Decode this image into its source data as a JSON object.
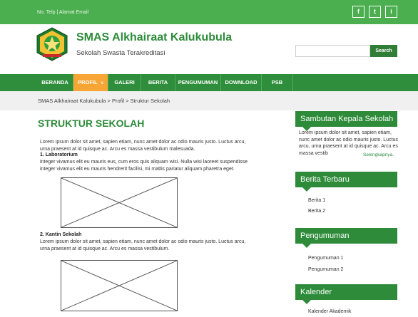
{
  "topbar": {
    "contact": "No. Telp | Alamat Email",
    "social": [
      "f",
      "t",
      "i"
    ]
  },
  "header": {
    "title": "SMAS Alkhairaat Kalukubula",
    "subtitle": "Sekolah Swasta Terakreditasi",
    "search_placeholder": "",
    "search_button": "Search"
  },
  "nav": {
    "items": [
      "BERANDA",
      "PROFIL",
      "GALERI",
      "BERITA",
      "PENGUMUMAN",
      "DOWNLOAD",
      "PSB"
    ],
    "active": "PROFIL",
    "chevron": "v"
  },
  "breadcrumb": "SMAS Alkhairaat Kalukubula > Profil > Struktur Sekolah",
  "main": {
    "title": "STRUKTUR SEKOLAH",
    "intro": "Lorem ipsum dolor sit amet, sapien etiam, nunc amet dolor ac odio mauris justo. Luctus arcu, urna praesent at id quisque ac. Arcu es massa vestibulum malesuada.",
    "s1_title": "1. Laboratorium",
    "s1_text": "integer vivamus elit eu mauris eus, cum eros quis aliquam wisi. Nulla wisi laoreet suspendisse integer vivamus elit eu mauris hendrerit facilisi, mi mattis pariatur aliquam pharetra eget.",
    "s2_title": "2. Kantin Sekolah",
    "s2_text": "Lorem ipsum dolor sit amet, sapien etiam, nunc amet dolor ac odio mauris justo. Luctus arcu, urna praesent at id quisque ac. Arcu es massa vestibulum."
  },
  "sidebar": {
    "welcome_title": "Sambutan Kepala Sekolah",
    "welcome_text": "Lorem ipsum dolor sit amet, sapien etiam, nunc amet dolor ac odio mauris justo. Luctus arcu, urna praesent at id quisque ac. Arcu es massa vestib",
    "welcome_more": "Selengkapnya.",
    "news_title": "Berita Terbaru",
    "news": [
      "Berita 1",
      "Berita 2"
    ],
    "ann_title": "Pengumuman",
    "announcements": [
      "Pengumuman 1",
      "Pengumuman 2"
    ],
    "cal_title": "Kalender",
    "calendar": [
      "Kalender Akademik"
    ]
  },
  "colors": {
    "topbar": "#4bae4f",
    "brand_green": "#2e8b3a",
    "nav_active": "#f7a535",
    "breadcrumb_bg": "#f0f0f0"
  },
  "icons": {
    "social": [
      "facebook-icon",
      "twitter-icon",
      "instagram-icon"
    ],
    "logo": "school-emblem"
  }
}
